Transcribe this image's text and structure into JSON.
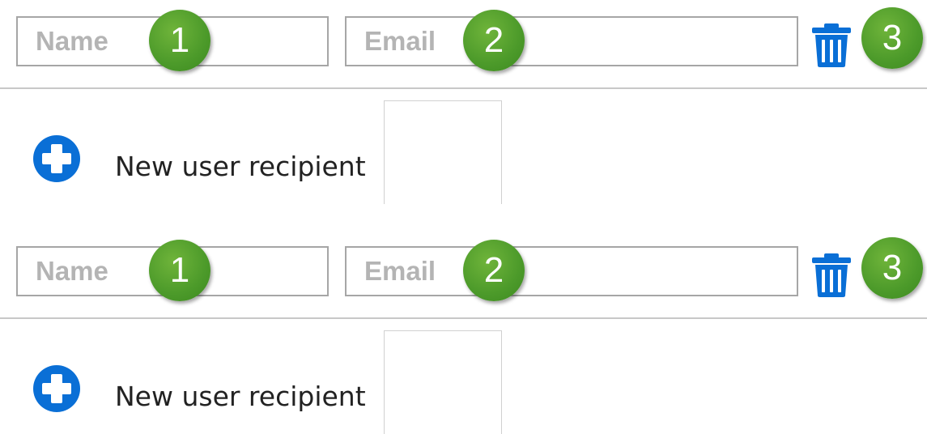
{
  "colors": {
    "badge_green": "#4c9a2a",
    "accent_blue": "#0a6fd6",
    "field_border": "#a6a6a6",
    "placeholder_gray": "#b4b4b4"
  },
  "rows": [
    {
      "name_placeholder": "Name",
      "email_placeholder": "Email",
      "badges": [
        "1",
        "2",
        "3"
      ],
      "delete_icon": "trash-icon",
      "add_icon": "plus-circle-icon",
      "add_label": "New user recipient"
    },
    {
      "name_placeholder": "Name",
      "email_placeholder": "Email",
      "badges": [
        "1",
        "2",
        "3"
      ],
      "delete_icon": "trash-icon",
      "add_icon": "plus-circle-icon",
      "add_label": "New user recipient"
    }
  ]
}
